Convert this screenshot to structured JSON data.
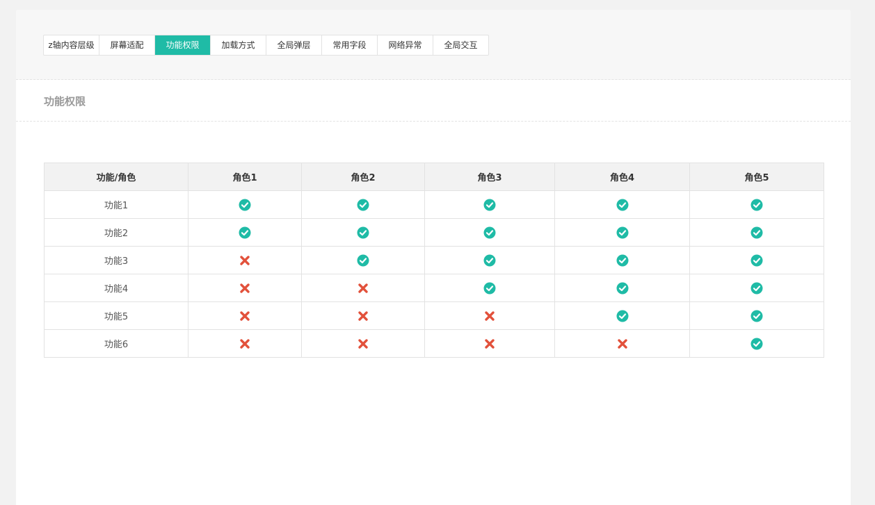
{
  "tabs": [
    {
      "label": "z轴内容层级",
      "active": false
    },
    {
      "label": "屏幕适配",
      "active": false
    },
    {
      "label": "功能权限",
      "active": true
    },
    {
      "label": "加载方式",
      "active": false
    },
    {
      "label": "全局弹层",
      "active": false
    },
    {
      "label": "常用字段",
      "active": false
    },
    {
      "label": "网络异常",
      "active": false
    },
    {
      "label": "全局交互",
      "active": false
    }
  ],
  "section": {
    "title": "功能权限"
  },
  "table": {
    "headers": [
      "功能/角色",
      "角色1",
      "角色2",
      "角色3",
      "角色4",
      "角色5"
    ],
    "rows": [
      {
        "label": "功能1",
        "perms": [
          true,
          true,
          true,
          true,
          true
        ]
      },
      {
        "label": "功能2",
        "perms": [
          true,
          true,
          true,
          true,
          true
        ]
      },
      {
        "label": "功能3",
        "perms": [
          false,
          true,
          true,
          true,
          true
        ]
      },
      {
        "label": "功能4",
        "perms": [
          false,
          false,
          true,
          true,
          true
        ]
      },
      {
        "label": "功能5",
        "perms": [
          false,
          false,
          false,
          true,
          true
        ]
      },
      {
        "label": "功能6",
        "perms": [
          false,
          false,
          false,
          false,
          true
        ]
      }
    ]
  },
  "icons": {
    "allowed": "check-circle-icon",
    "denied": "cross-icon"
  },
  "colors": {
    "accent": "#1fbba6",
    "allowed": "#1fbba6",
    "denied": "#e2513b"
  }
}
